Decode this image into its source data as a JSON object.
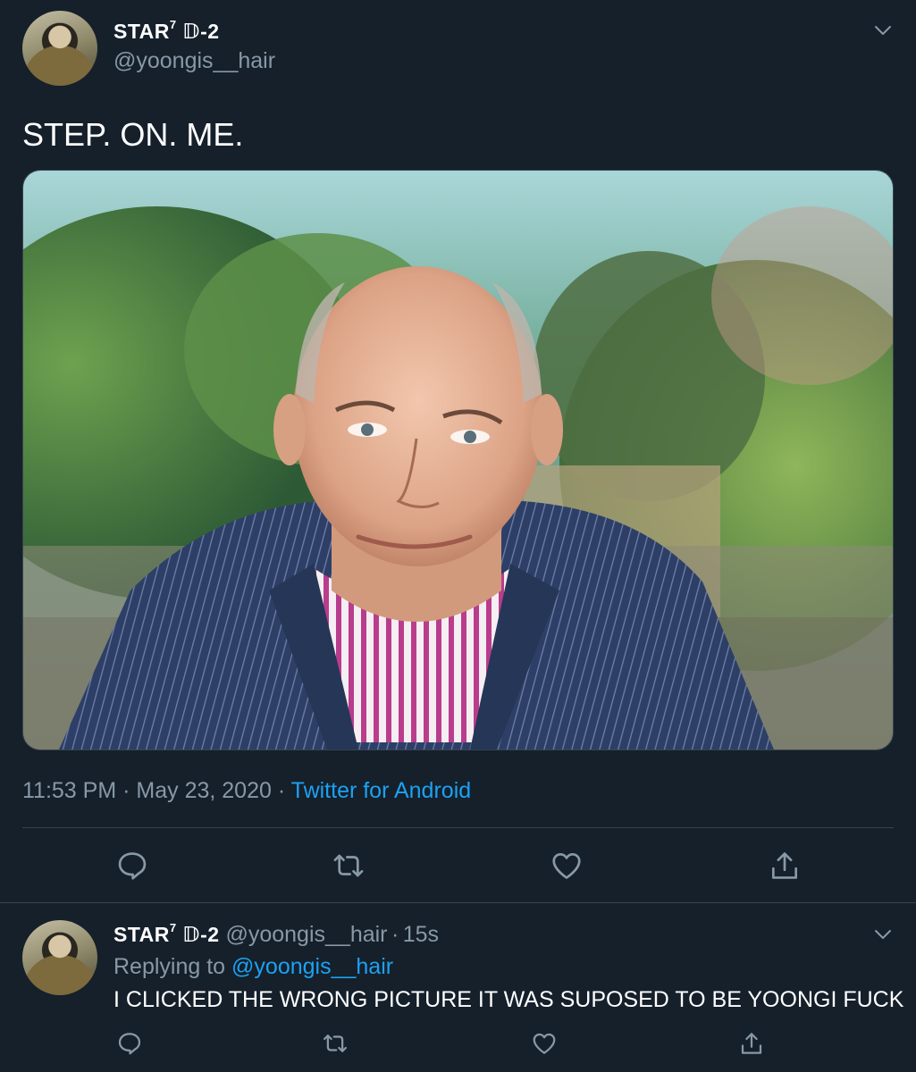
{
  "tweet": {
    "display_name": "STAR",
    "display_name_sup": "7",
    "display_name_suffix": "𝔻-2",
    "handle": "@yoongis__hair",
    "text": "STEP. ON. ME.",
    "time": "11:53 PM",
    "date": "May 23, 2020",
    "source": "Twitter for Android",
    "separator": "·"
  },
  "reply": {
    "display_name": "STAR",
    "display_name_sup": "7",
    "display_name_suffix": "𝔻-2",
    "handle": "@yoongis__hair",
    "age": "15s",
    "separator": "·",
    "replying_prefix": "Replying to",
    "replying_to": "@yoongis__hair",
    "text": "I CLICKED THE WRONG PICTURE IT WAS SUPOSED TO BE YOONGI FUCK"
  },
  "icons": {
    "reply": "comment-icon",
    "retweet": "retweet-icon",
    "like": "heart-icon",
    "share": "share-icon",
    "menu": "chevron-down-icon"
  },
  "colors": {
    "background": "#15202b",
    "secondary_text": "#8899a6",
    "link": "#1da1f2",
    "divider": "#38444d"
  }
}
